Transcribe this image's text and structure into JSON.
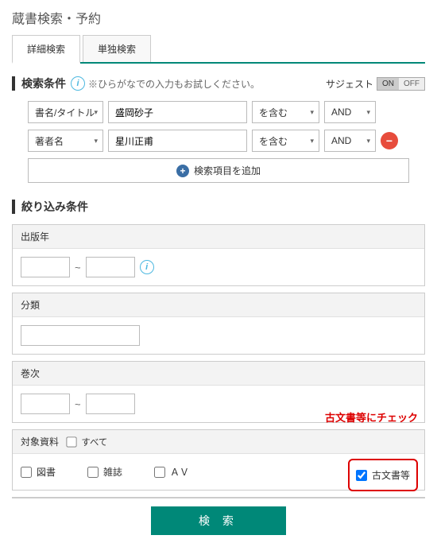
{
  "page_title": "蔵書検索・予約",
  "tabs": {
    "detail": "詳細検索",
    "single": "単独検索"
  },
  "conditions": {
    "title": "検索条件",
    "hint": "※ひらがなでの入力もお試しください。",
    "suggest_label": "サジェスト",
    "on": "ON",
    "off": "OFF",
    "rows": [
      {
        "field": "書名/タイトル",
        "value": "盛岡砂子",
        "match": "を含む",
        "logic": "AND"
      },
      {
        "field": "著者名",
        "value": "星川正甫",
        "match": "を含む",
        "logic": "AND"
      }
    ],
    "add_label": "検索項目を追加"
  },
  "filters": {
    "title": "絞り込み条件",
    "pub_year": "出版年",
    "classification": "分類",
    "volume": "巻次",
    "target_materials": "対象資料",
    "all": "すべて",
    "types": {
      "book": "図書",
      "magazine": "雑誌",
      "av": "ＡＶ",
      "old_docs": "古文書等"
    }
  },
  "callout": "古文書等にチェック",
  "search_button": "検 索"
}
